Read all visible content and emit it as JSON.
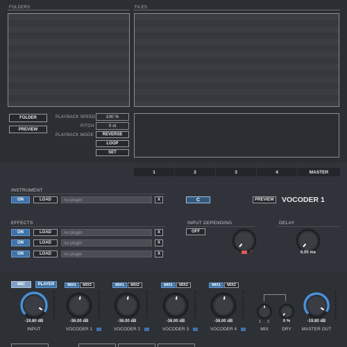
{
  "browser": {
    "folders_label": "FOLDERS",
    "files_label": "FILES",
    "folder_button": "FOLDER",
    "preview_button": "PREVIEW"
  },
  "playback": {
    "speed_label": "PLAYBACK SPEED",
    "speed_value": "100 %",
    "pitch_label": "PITCH",
    "pitch_value": "0 st",
    "mode_label": "PLAYBACK MODE",
    "reverse_label": "REVERSE",
    "loop_label": "LOOP",
    "set_label": "SET"
  },
  "tabs": [
    {
      "label": "1",
      "active": true
    },
    {
      "label": "2",
      "active": false
    },
    {
      "label": "3",
      "active": false
    },
    {
      "label": "4",
      "active": false
    },
    {
      "label": "MASTER",
      "active": false
    }
  ],
  "instrument": {
    "section_label": "INSTRUMENT",
    "on_label": "ON",
    "load_label": "LOAD",
    "plugin_name": "no plugin",
    "close_label": "X",
    "key_value": "C",
    "preview_label": "PREVIEW",
    "vocoder_title": "VOCODER 1"
  },
  "effects": {
    "section_label": "EFFECTS",
    "slots": [
      {
        "on": "ON",
        "load": "LOAD",
        "plugin": "no plugin",
        "close": "X"
      },
      {
        "on": "ON",
        "load": "LOAD",
        "plugin": "no plugin",
        "close": "X"
      },
      {
        "on": "ON",
        "load": "LOAD",
        "plugin": "no plugin",
        "close": "X"
      }
    ]
  },
  "input_depending": {
    "label": "INPUT DEPENDING",
    "off_label": "OFF",
    "minus": "-",
    "plus": "+"
  },
  "delay": {
    "label": "DELAY",
    "value": "0.00 ms",
    "knob_fraction": 0.0
  },
  "mixer": {
    "mic_label": "MIC",
    "player_label": "PLAYER",
    "input": {
      "value": "-19.80 dB",
      "label": "INPUT"
    },
    "vocoders": [
      {
        "mix1": "MIX1",
        "mix2": "MIX2",
        "value": "-36.00 dB",
        "label": "VOCODER 1"
      },
      {
        "mix1": "MIX1",
        "mix2": "MIX2",
        "value": "-36.00 dB",
        "label": "VOCODER 2"
      },
      {
        "mix1": "MIX1",
        "mix2": "MIX2",
        "value": "-36.00 dB",
        "label": "VOCODER 3"
      },
      {
        "mix1": "MIX1",
        "mix2": "MIX2",
        "value": "-36.00 dB",
        "label": "VOCODER 4"
      }
    ],
    "mix": {
      "label": "MIX",
      "left": "1",
      "right": "2"
    },
    "dry": {
      "value": "0 %",
      "label": "DRY"
    },
    "master": {
      "value": "-19.80 dB",
      "label": "MASTER OUT"
    }
  },
  "colors": {
    "accent": "#3f73a8",
    "knob_ring": "#4a90d9",
    "background": "#2b2e33"
  }
}
